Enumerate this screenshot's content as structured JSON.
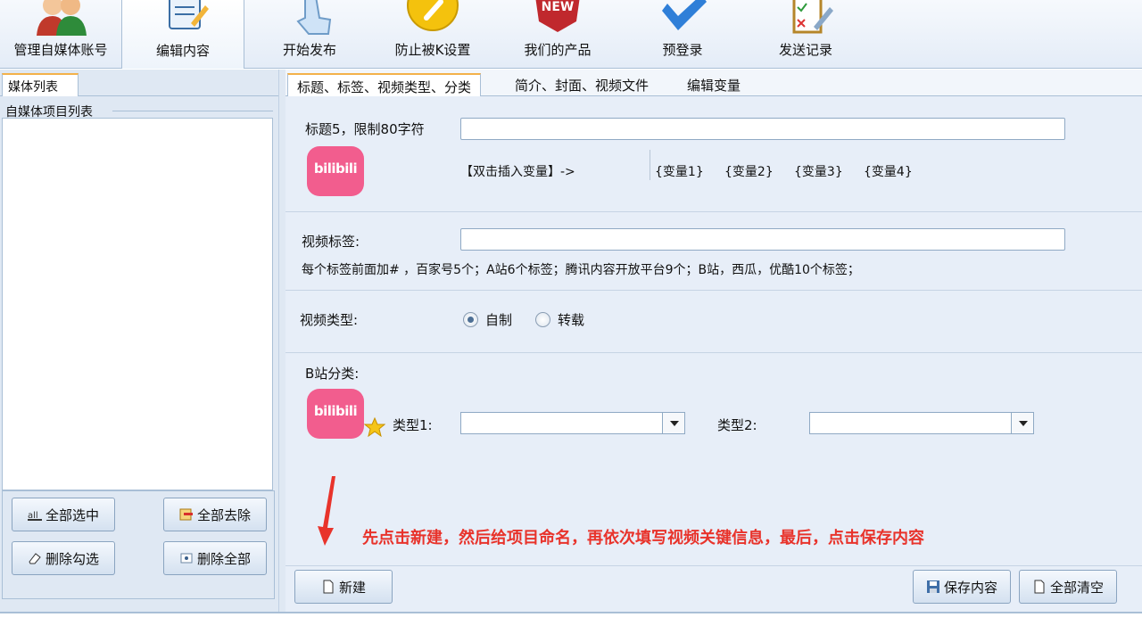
{
  "toolbar": {
    "items": [
      {
        "label": "管理自媒体账号",
        "icon": "people-icon"
      },
      {
        "label": "编辑内容",
        "icon": "notepad-edit-icon"
      },
      {
        "label": "开始发布",
        "icon": "hand-cursor-icon"
      },
      {
        "label": "防止被K设置",
        "icon": "wrench-badge-icon"
      },
      {
        "label": "我们的产品",
        "icon": "new-badge-icon"
      },
      {
        "label": "预登录",
        "icon": "checkmark-icon"
      },
      {
        "label": "发送记录",
        "icon": "checklist-icon"
      }
    ]
  },
  "left": {
    "tab": "媒体列表",
    "group_title": "自媒体项目列表",
    "buttons": {
      "select_all": "全部选中",
      "remove_all": "全部去除",
      "delete_checked": "删除勾选",
      "delete_all": "删除全部"
    }
  },
  "tabs": [
    "标题、标签、视频类型、分类",
    "简介、封面、视频文件",
    "编辑变量"
  ],
  "title_section": {
    "label": "标题5，限制80字符",
    "title_value": "",
    "insert_var_label": "【双击插入变量】->",
    "variables": [
      "{变量1}",
      "{变量2}",
      "{变量3}",
      "{变量4}"
    ],
    "logo_text": "bilibili"
  },
  "tags_section": {
    "label": "视频标签:",
    "tags_value": "",
    "note": "每个标签前面加# ，百家号5个；A站6个标签；腾讯内容开放平台9个；B站，西瓜，优酷10个标签；"
  },
  "type_section": {
    "label": "视频类型:",
    "options": [
      "自制",
      "转载"
    ],
    "selected": "自制"
  },
  "category_section": {
    "label": "B站分类:",
    "logo_text": "bilibili",
    "type1_label": "类型1:",
    "type1_value": "",
    "type2_label": "类型2:",
    "type2_value": ""
  },
  "hint_text": "先点击新建，然后给项目命名，再依次填写视频关键信息，最后，点击保存内容",
  "bottom": {
    "new_label": "新建",
    "save_label": "保存内容",
    "clear_label": "全部清空"
  },
  "colors": {
    "hint": "#e8332b",
    "bilibili": "#f25d8e",
    "tab_accent": "#f3b14a"
  }
}
